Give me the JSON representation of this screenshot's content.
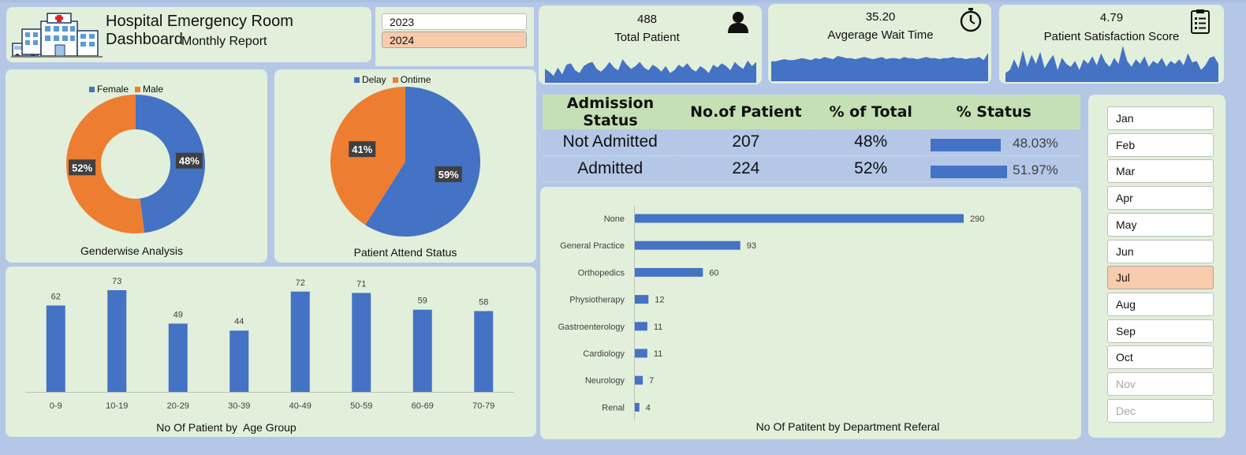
{
  "header": {
    "title": "Hospital Emergency Room Dashboard",
    "subtitle": "Monthly Report"
  },
  "years": [
    {
      "label": "2023",
      "selected": false
    },
    {
      "label": "2024",
      "selected": true
    }
  ],
  "kpis": {
    "total": {
      "value": "488",
      "label": "Total Patient",
      "icon": "person-icon"
    },
    "wait": {
      "value": "35.20",
      "label": "Avgerage Wait Time",
      "icon": "stopwatch-icon"
    },
    "satisfaction": {
      "value": "4.79",
      "label": "Patient Satisfaction Score",
      "icon": "checklist-icon"
    }
  },
  "admission": {
    "headers": [
      "Admission Status",
      "No.of Patient",
      "% of Total",
      "% Status"
    ],
    "rows": [
      {
        "status": "Not Admitted",
        "count": "207",
        "pct": "48%",
        "bar": 48.03,
        "bar_label": "48.03%"
      },
      {
        "status": "Admitted",
        "count": "224",
        "pct": "52%",
        "bar": 51.97,
        "bar_label": "51.97%"
      }
    ]
  },
  "months": [
    {
      "label": "Jan",
      "state": "normal"
    },
    {
      "label": "Feb",
      "state": "normal"
    },
    {
      "label": "Mar",
      "state": "normal"
    },
    {
      "label": "Apr",
      "state": "normal"
    },
    {
      "label": "May",
      "state": "normal"
    },
    {
      "label": "Jun",
      "state": "normal"
    },
    {
      "label": "Jul",
      "state": "selected"
    },
    {
      "label": "Aug",
      "state": "normal"
    },
    {
      "label": "Sep",
      "state": "normal"
    },
    {
      "label": "Oct",
      "state": "normal"
    },
    {
      "label": "Nov",
      "state": "disabled"
    },
    {
      "label": "Dec",
      "state": "disabled"
    }
  ],
  "colors": {
    "blue": "#4472c4",
    "orange": "#ed7d31",
    "panel": "#e2efda",
    "background": "#b4c7e7",
    "selected": "#f8cbad"
  },
  "chart_data": [
    {
      "id": "gender",
      "type": "pie",
      "variant": "donut",
      "title": "Genderwise Analysis",
      "legend_position": "top",
      "series": [
        {
          "name": "Female",
          "value": 48,
          "label": "48%"
        },
        {
          "name": "Male",
          "value": 52,
          "label": "52%"
        }
      ]
    },
    {
      "id": "attend",
      "type": "pie",
      "title": "Patient Attend Status",
      "legend_position": "top",
      "series": [
        {
          "name": "Delay",
          "value": 59,
          "label": "59%"
        },
        {
          "name": "Ontime",
          "value": 41,
          "label": "41%"
        }
      ]
    },
    {
      "id": "age",
      "type": "bar",
      "title": "No Of Patient by  Age Group",
      "categories": [
        "0-9",
        "10-19",
        "20-29",
        "30-39",
        "40-49",
        "50-59",
        "60-69",
        "70-79"
      ],
      "values": [
        62,
        73,
        49,
        44,
        72,
        71,
        59,
        58
      ],
      "ylim": [
        0,
        73
      ]
    },
    {
      "id": "dept",
      "type": "bar",
      "orientation": "horizontal",
      "title": "No Of Patitent by Department Referal",
      "categories": [
        "None",
        "General Practice",
        "Orthopedics",
        "Physiotherapy",
        "Gastroenterology",
        "Cardiology",
        "Neurology",
        "Renal"
      ],
      "values": [
        290,
        93,
        60,
        12,
        11,
        11,
        7,
        4
      ],
      "xlim": [
        0,
        290
      ]
    },
    {
      "id": "spark_total",
      "type": "area",
      "values": [
        10,
        8,
        5,
        11,
        6,
        13,
        14,
        9,
        7,
        12,
        14,
        15,
        10,
        8,
        11,
        15,
        11,
        9,
        17,
        13,
        10,
        12,
        15,
        11,
        9,
        13,
        11,
        8,
        12,
        7,
        9,
        13,
        11,
        14,
        10,
        8,
        12,
        10,
        7,
        13,
        11,
        14,
        12,
        9,
        15,
        12,
        10,
        16,
        12,
        15
      ]
    },
    {
      "id": "spark_wait",
      "type": "area",
      "values": [
        19,
        19,
        20,
        21,
        20,
        20,
        21,
        22,
        21,
        20,
        22,
        21,
        23,
        22,
        21,
        24,
        23,
        22,
        22,
        21,
        22,
        23,
        22,
        21,
        22,
        23,
        21,
        22,
        22,
        21,
        23,
        22,
        22,
        21,
        22,
        23,
        22,
        22,
        21,
        22,
        22,
        23,
        22,
        22,
        21,
        22,
        22,
        23,
        20,
        27
      ]
    },
    {
      "id": "spark_satisfaction",
      "type": "area",
      "values": [
        6,
        8,
        15,
        9,
        21,
        10,
        18,
        12,
        20,
        9,
        14,
        18,
        8,
        16,
        12,
        10,
        14,
        8,
        15,
        12,
        17,
        11,
        19,
        13,
        10,
        16,
        12,
        24,
        14,
        10,
        15,
        12,
        17,
        10,
        14,
        12,
        16,
        10,
        14,
        12,
        15,
        11,
        19,
        13,
        14,
        8,
        11,
        16,
        17,
        12
      ]
    }
  ]
}
